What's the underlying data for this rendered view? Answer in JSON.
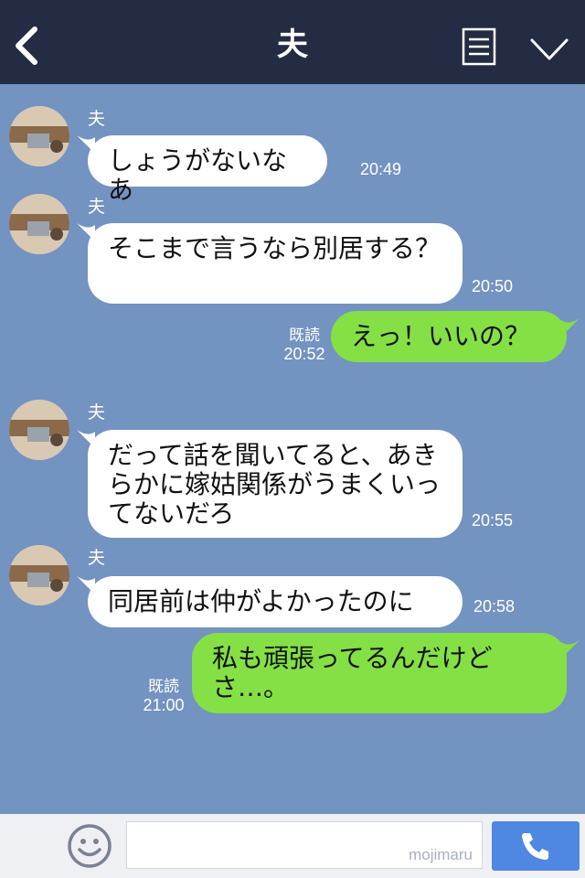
{
  "header": {
    "title": "夫"
  },
  "messages": [
    {
      "sender": "夫",
      "text": "しょうがないなあ",
      "time": "20:49"
    },
    {
      "sender": "夫",
      "text": "そこまで言うなら別居する？",
      "time": "20:50"
    },
    {
      "text": "えっ！いいの？",
      "read": "既読",
      "time": "20:52"
    },
    {
      "sender": "夫",
      "text": "だって話を聞いてると、あきらかに嫁姑関係がうまくいってないだろ",
      "time": "20:55"
    },
    {
      "sender": "夫",
      "text": "同居前は仲がよかったのに",
      "time": "20:58"
    },
    {
      "text": "私も頑張ってるんだけどさ…。",
      "read": "既読",
      "time": "21:00"
    }
  ],
  "footer": {
    "watermark": "mojimaru"
  },
  "colors": {
    "header": "#232c43",
    "background": "#7393c1",
    "incoming": "#ffffff",
    "outgoing": "#84e045",
    "call_button": "#4e88e3"
  },
  "icons": {
    "back": "chevron-left-icon",
    "list": "list-icon",
    "collapse": "chevron-down-icon",
    "add": "plus-icon",
    "sticker": "smiley-icon",
    "call": "phone-icon"
  }
}
